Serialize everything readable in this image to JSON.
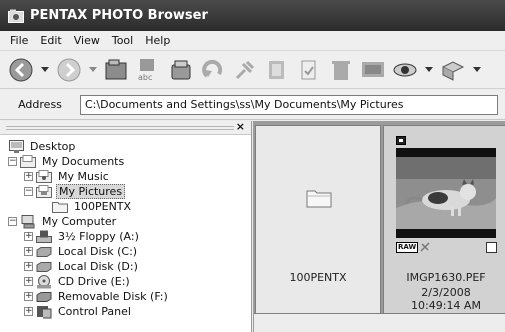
{
  "window": {
    "title": "PENTAX PHOTO Browser"
  },
  "menu": [
    "File",
    "Edit",
    "View",
    "Tool",
    "Help"
  ],
  "address": {
    "label": "Address",
    "value": "C:\\Documents and Settings\\ss\\My Documents\\My Pictures"
  },
  "tree": [
    {
      "label": "Desktop",
      "icon": "desktop-icon"
    },
    {
      "label": "My Documents",
      "icon": "documents-folder-icon"
    },
    {
      "label": "My Music",
      "icon": "music-folder-icon"
    },
    {
      "label": "My Pictures",
      "icon": "pictures-folder-icon"
    },
    {
      "label": "100PENTX",
      "icon": "folder-icon"
    },
    {
      "label": "My Computer",
      "icon": "computer-icon"
    },
    {
      "label": "3½ Floppy (A:)",
      "icon": "floppy-drive-icon"
    },
    {
      "label": "Local Disk (C:)",
      "icon": "hard-disk-icon"
    },
    {
      "label": "Local Disk (D:)",
      "icon": "hard-disk-icon"
    },
    {
      "label": "CD Drive (E:)",
      "icon": "cd-drive-icon"
    },
    {
      "label": "Removable Disk (F:)",
      "icon": "removable-disk-icon"
    },
    {
      "label": "Control Panel",
      "icon": "control-panel-icon"
    }
  ],
  "thumbnails": [
    {
      "name": "100PENTX",
      "type": "folder"
    },
    {
      "name": "IMGP1630.PEF",
      "date": "2/3/2008",
      "time": "10:49:14 AM",
      "badge": "RAW",
      "type": "image"
    }
  ]
}
